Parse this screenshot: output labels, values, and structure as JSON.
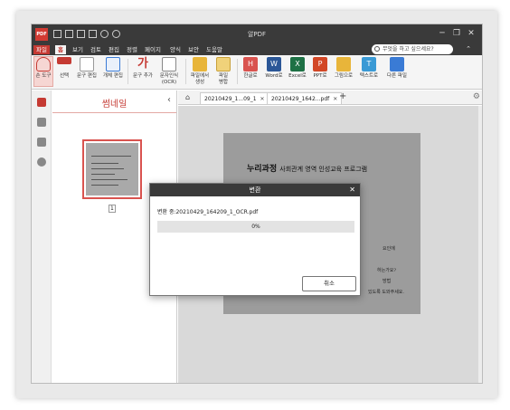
{
  "app": {
    "logo_text": "PDF",
    "title": "알PDF"
  },
  "window": {
    "minimize": "─",
    "restore": "❐",
    "close": "✕"
  },
  "menu": {
    "items": [
      "파일",
      "홈",
      "보기",
      "검토",
      "편집",
      "정렬",
      "페이지",
      "양식",
      "보안",
      "도움말"
    ],
    "active_index": 1,
    "search_placeholder": "무엇을 하고 싶으세요?",
    "collapse": "⌃"
  },
  "ribbon": {
    "buttons": [
      {
        "label": "손 도구",
        "icon": "hand-icon",
        "color": "#c53a33"
      },
      {
        "label": "선택",
        "icon": "select-text-icon",
        "color": "#c53a33"
      },
      {
        "label": "문구 편집",
        "icon": "edit-text-icon",
        "color": "#d9534f"
      },
      {
        "label": "개체 편집",
        "icon": "edit-object-icon",
        "color": "#3a7bd5"
      },
      {
        "label": "문구 추가",
        "icon": "add-text-icon",
        "color": "#c53a33"
      },
      {
        "label": "문자인식\n(OCR)",
        "icon": "ocr-icon",
        "color": "#555555"
      },
      {
        "label": "파일에서\n생성",
        "icon": "folder-icon",
        "color": "#e8b53a"
      },
      {
        "label": "파일\n병합",
        "icon": "merge-icon",
        "color": "#e8b53a"
      },
      {
        "label": "한글로",
        "icon": "hwp-icon",
        "color": "#d9534f"
      },
      {
        "label": "Word로",
        "icon": "word-icon",
        "color": "#2b5797"
      },
      {
        "label": "Excel로",
        "icon": "excel-icon",
        "color": "#1e7145"
      },
      {
        "label": "PPT로",
        "icon": "ppt-icon",
        "color": "#d24726"
      },
      {
        "label": "그림으로",
        "icon": "image-icon",
        "color": "#e8b53a"
      },
      {
        "label": "텍스트로",
        "icon": "text-icon",
        "color": "#3a9ad5"
      },
      {
        "label": "다른 파일",
        "icon": "other-file-icon",
        "color": "#3a7bd5"
      }
    ]
  },
  "thumbnail": {
    "title": "썸네일",
    "collapse_glyph": "‹",
    "page_number": "1"
  },
  "tabs": {
    "home_glyph": "⌂",
    "items": [
      {
        "label": "20210429_1...09_1",
        "close": "✕"
      },
      {
        "label": "20210429_1642...pdf",
        "close": "✕"
      }
    ],
    "add": "+",
    "settings_glyph": "⚙"
  },
  "document": {
    "heading_bold": "누리과정",
    "heading_rest": "사회관계 영역 인성교육 프로그램",
    "lines": [
      "요인에",
      "하는가요?",
      "방법",
      "있도록 도와주세요."
    ]
  },
  "dialog": {
    "title": "변환",
    "close": "✕",
    "status": "변환 중:20210429_164209_1_OCR.pdf",
    "progress_text": "0%",
    "progress_value": 0,
    "cancel_label": "취소"
  }
}
